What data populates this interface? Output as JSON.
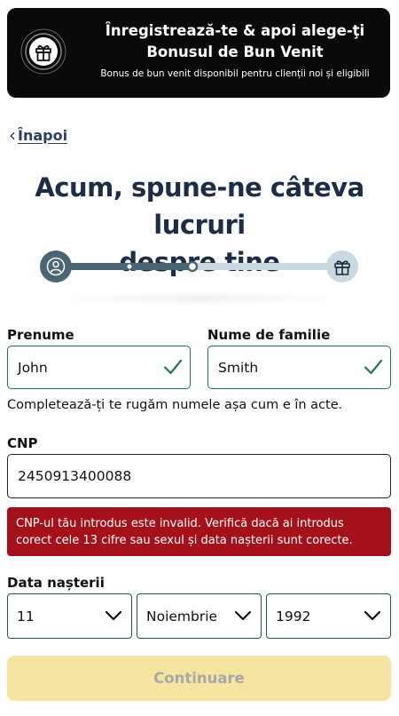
{
  "banner": {
    "title_line1": "Înregistrează-te & apoi alege-ţi",
    "title_line2": "Bonusul de Bun Venit",
    "subtitle": "Bonus de bun venit disponibil pentru clienții noi și eligibili",
    "icon": "gift-icon"
  },
  "nav": {
    "back_label": "Înapoi"
  },
  "headline": {
    "line1": "Acum, spune-ne câteva lucruri",
    "line2": "despre tine"
  },
  "progress": {
    "steps_icons": [
      "user-icon",
      "gift-icon"
    ],
    "completed_fraction": 0.5
  },
  "form": {
    "first_name": {
      "label": "Prenume",
      "value": "John",
      "valid": true
    },
    "last_name": {
      "label": "Nume de familie",
      "value": "Smith",
      "valid": true
    },
    "name_hint": "Completează-ți te rugăm numele așa cum e în acte.",
    "cnp": {
      "label": "CNP",
      "value": "2450913400088"
    },
    "cnp_error": "CNP-ul tău introdus este invalid. Verifică dacă ai introdus corect cele 13 cifre sau sexul și data nașterii sunt corecte.",
    "dob": {
      "label": "Data nașterii",
      "day": "11",
      "month": "Noiembrie",
      "year": "1992"
    }
  },
  "cta": {
    "label": "Continuare",
    "enabled": false
  },
  "colors": {
    "banner_bg": "#0a0a0a",
    "heading": "#1c2d45",
    "valid_border": "#1f7a4a",
    "error_bg": "#a4111a",
    "cta_disabled_bg": "#f6e4a1",
    "progress_active": "#4a6574",
    "progress_inactive": "#cad8e1"
  }
}
